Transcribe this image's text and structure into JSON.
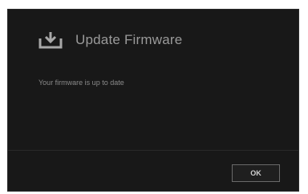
{
  "dialog": {
    "title": "Update Firmware",
    "title_icon": "download-tray-icon",
    "message": "Your firmware is up to date",
    "ok_label": "OK"
  },
  "colors": {
    "dialog_background": "#181818",
    "title_text": "#9a9a9a",
    "message_text": "#8a8a8a",
    "button_border": "#6a6a6a"
  }
}
